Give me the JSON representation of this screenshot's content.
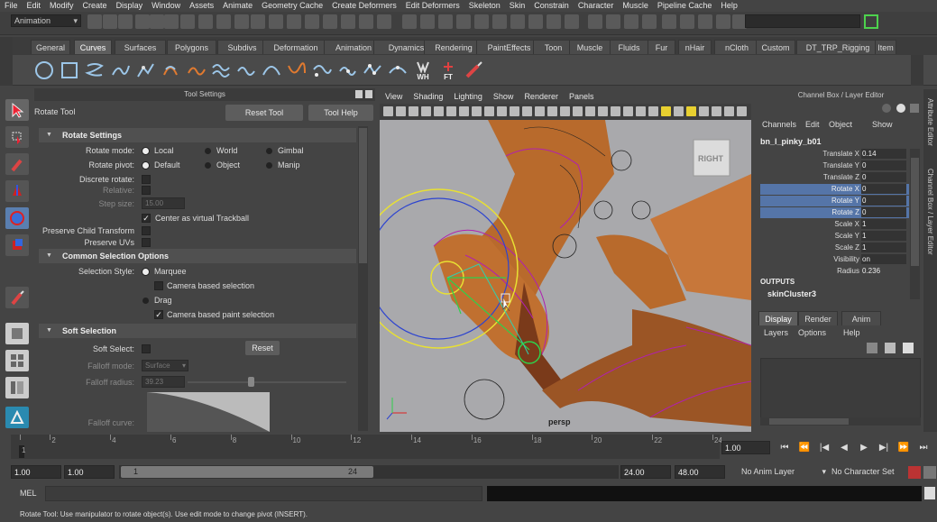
{
  "menubar": {
    "items": [
      "File",
      "Edit",
      "Modify",
      "Create",
      "Display",
      "Window",
      "Assets",
      "Animate",
      "Geometry Cache",
      "Create Deformers",
      "Edit Deformers",
      "Skeleton",
      "Skin",
      "Constrain",
      "Character",
      "Muscle",
      "Pipeline Cache",
      "Help"
    ]
  },
  "status": {
    "mode": "Animation"
  },
  "shelf": {
    "tabs": [
      "General",
      "Curves",
      "Surfaces",
      "Polygons",
      "Subdivs",
      "Deformation",
      "Animation",
      "Dynamics",
      "Rendering",
      "PaintEffects",
      "Toon",
      "Muscle",
      "Fluids",
      "Fur",
      "nHair",
      "nCloth",
      "Custom",
      "DT_TRP_Rigging",
      "Item"
    ],
    "active_tab": "Curves",
    "icon_labels": {
      "wh": "WH",
      "ft": "FT"
    }
  },
  "tool_settings": {
    "panel_title": "Tool Settings",
    "tool_name": "Rotate Tool",
    "reset_tool": "Reset Tool",
    "tool_help": "Tool Help",
    "rotate_section": "Rotate Settings",
    "rotate_mode_label": "Rotate mode:",
    "rotate_mode_options": [
      "Local",
      "World",
      "Gimbal"
    ],
    "rotate_pivot_label": "Rotate pivot:",
    "rotate_pivot_options": [
      "Default",
      "Object",
      "Manip"
    ],
    "discrete_rotate": "Discrete rotate:",
    "relative": "Relative:",
    "step_size": "Step size:",
    "step_size_value": "15.00",
    "center_trackball": "Center as virtual Trackball",
    "preserve_child": "Preserve Child Transform",
    "preserve_uvs": "Preserve UVs",
    "common_section": "Common Selection Options",
    "selection_style_label": "Selection Style:",
    "marquee": "Marquee",
    "camera_based_selection": "Camera based selection",
    "drag": "Drag",
    "camera_based_paint": "Camera based paint selection",
    "soft_section": "Soft Selection",
    "soft_select": "Soft Select:",
    "reset": "Reset",
    "falloff_mode": "Falloff mode:",
    "falloff_mode_value": "Surface",
    "falloff_radius": "Falloff radius:",
    "falloff_radius_value": "39.23",
    "falloff_curve": "Falloff curve:"
  },
  "viewport": {
    "menu": [
      "View",
      "Shading",
      "Lighting",
      "Show",
      "Renderer",
      "Panels"
    ],
    "camera_label": "persp",
    "viewcube_label": "RIGHT"
  },
  "channel_box": {
    "title": "Channel Box / Layer Editor",
    "menu": [
      "Channels",
      "Edit",
      "Object",
      "Show"
    ],
    "object_name": "bn_l_pinky_b01",
    "attributes": [
      {
        "name": "Translate X",
        "value": "0.14",
        "selected": false
      },
      {
        "name": "Translate Y",
        "value": "0",
        "selected": false
      },
      {
        "name": "Translate Z",
        "value": "0",
        "selected": false
      },
      {
        "name": "Rotate X",
        "value": "0",
        "selected": true
      },
      {
        "name": "Rotate Y",
        "value": "0",
        "selected": true
      },
      {
        "name": "Rotate Z",
        "value": "0",
        "selected": true
      },
      {
        "name": "Scale X",
        "value": "1",
        "selected": false
      },
      {
        "name": "Scale Y",
        "value": "1",
        "selected": false
      },
      {
        "name": "Scale Z",
        "value": "1",
        "selected": false
      },
      {
        "name": "Visibility",
        "value": "on",
        "selected": false
      }
    ],
    "radius_label": "Radius",
    "radius_value": "0.236",
    "outputs_label": "OUTPUTS",
    "output_node": "skinCluster3"
  },
  "layer_editor": {
    "tabs": [
      "Display",
      "Render",
      "Anim"
    ],
    "active_tab": "Display",
    "menu": [
      "Layers",
      "Options",
      "Help"
    ]
  },
  "side_tabs": {
    "attribute_editor": "Attribute Editor",
    "channel_box": "Channel Box / Layer Editor"
  },
  "time_slider": {
    "ticks": [
      "1",
      "2",
      "4",
      "6",
      "8",
      "10",
      "12",
      "14",
      "16",
      "18",
      "20",
      "22",
      "24"
    ],
    "current_frame": "1.00"
  },
  "range_slider": {
    "start": "1.00",
    "start_inner": "1.00",
    "range_start_label": "1",
    "range_end_label": "24",
    "end": "24.00",
    "end_outer": "48.00",
    "anim_layer": "No Anim Layer",
    "character_set": "No Character Set"
  },
  "command_line": {
    "label": "MEL"
  },
  "help_line": {
    "text": "Rotate Tool: Use manipulator to rotate object(s). Use edit mode to change pivot (INSERT)."
  },
  "colors": {
    "accent_selected": "#5575a8",
    "skin": "#b86a2c",
    "wireframe": "#b020b0"
  }
}
